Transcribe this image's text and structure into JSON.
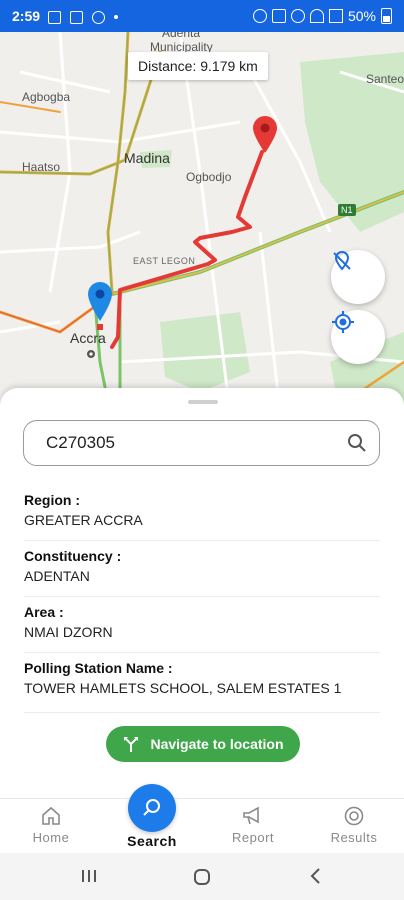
{
  "status_bar": {
    "time": "2:59",
    "battery": "50%"
  },
  "map": {
    "distance_text": "Distance: 9.179 km",
    "labels": {
      "adenta": "Adenta",
      "municipality": "Municipality",
      "santeo": "Santeo",
      "agbogba": "Agbogba",
      "madina": "Madina",
      "haatso": "Haatso",
      "ogbodjo": "Ogbodjo",
      "east_legon": "EAST LEGON",
      "accra": "Accra",
      "n1": "N1"
    },
    "route_color": "#e53935",
    "pin_start_color": "#1e88e5",
    "pin_end_color": "#e53935",
    "fab_top_icon": "location-off-icon",
    "fab_bottom_icon": "my-location-icon"
  },
  "search": {
    "value": "C270305",
    "icon": "search-icon"
  },
  "details": {
    "region_label": "Region :",
    "region_value": "GREATER ACCRA",
    "constituency_label": "Constituency :",
    "constituency_value": "ADENTAN",
    "area_label": "Area :",
    "area_value": "NMAI DZORN",
    "station_label": "Polling Station Name :",
    "station_value": "TOWER HAMLETS SCHOOL, SALEM ESTATES 1"
  },
  "navigate_button": {
    "label": "Navigate to location",
    "color": "#3fa64a",
    "icon": "fork-icon"
  },
  "bottom_nav": {
    "home": "Home",
    "search": "Search",
    "report": "Report",
    "results": "Results",
    "accent": "#1e7bea"
  }
}
